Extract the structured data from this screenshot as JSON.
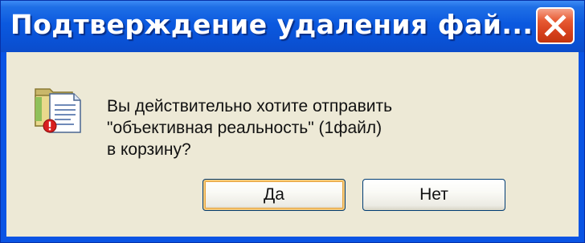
{
  "window": {
    "title": "Подтверждение удаления фай...",
    "close_icon": "close-icon"
  },
  "dialog": {
    "icon": "recycle-file-icon",
    "message_lines": [
      "Вы действительно хотите отправить",
      "\"объективная реальность\" (1файл)",
      "в корзину?"
    ]
  },
  "buttons": {
    "yes_label": "Да",
    "no_label": "Нет"
  },
  "colors": {
    "titlebar": "#0a54e4",
    "client_background": "#ede9d6",
    "close_button": "#d6401c",
    "default_button_focus": "#e8a33d"
  }
}
